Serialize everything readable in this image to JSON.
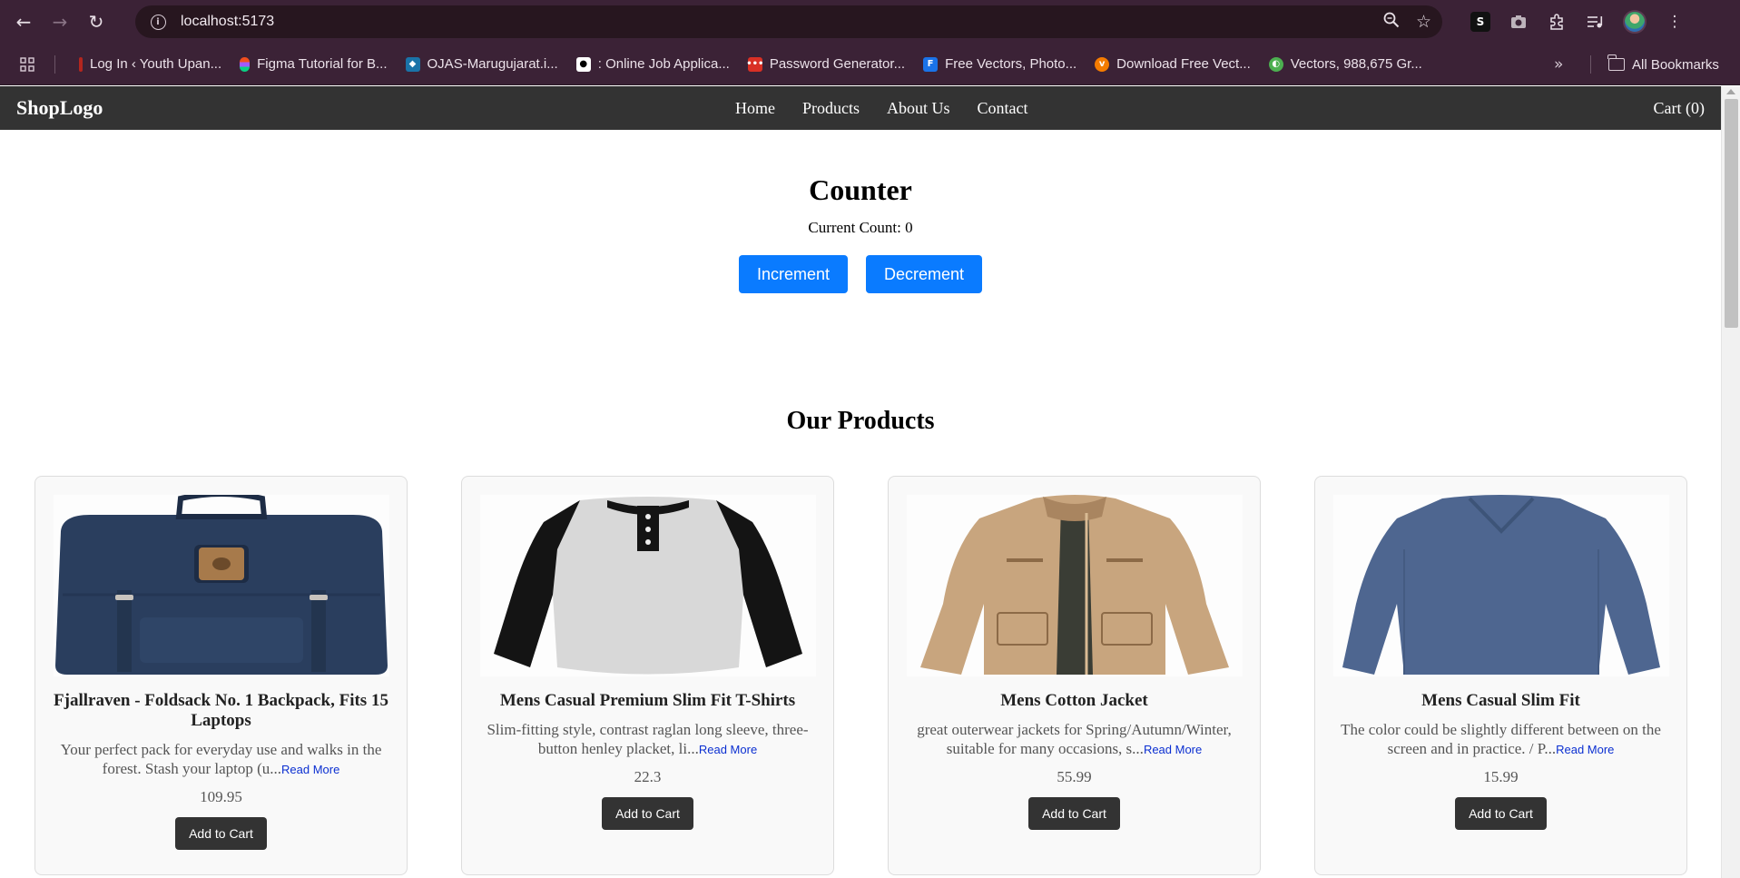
{
  "browser": {
    "url": "localhost:5173",
    "bookmarks": [
      {
        "label": "Log In ‹ Youth Upan...",
        "icon": "bookmark-favicon-red",
        "color": "#b3261e"
      },
      {
        "label": "Figma Tutorial for B...",
        "icon": "figma-icon",
        "color": "#f24e1e"
      },
      {
        "label": "OJAS-Marugujarat.i...",
        "icon": "bookmark-favicon-ojas",
        "color": "#1a73a8"
      },
      {
        "label": ": Online Job Applica...",
        "icon": "bookmark-favicon-job",
        "color": "#ffffff"
      },
      {
        "label": "Password Generator...",
        "icon": "bookmark-favicon-password",
        "color": "#d93025"
      },
      {
        "label": "Free Vectors, Photo...",
        "icon": "bookmark-favicon-freepik",
        "color": "#1a73e8"
      },
      {
        "label": "Download Free Vect...",
        "icon": "bookmark-favicon-vecteezy",
        "color": "#f57c00"
      },
      {
        "label": "Vectors, 988,675 Gr...",
        "icon": "bookmark-favicon-vectors",
        "color": "#4caf50"
      }
    ],
    "all_bookmarks_label": "All Bookmarks"
  },
  "site": {
    "logo": "ShopLogo",
    "nav": [
      "Home",
      "Products",
      "About Us",
      "Contact"
    ],
    "cart_label": "Cart (0)"
  },
  "counter": {
    "title": "Counter",
    "count_line": "Current Count: 0",
    "increment_label": "Increment",
    "decrement_label": "Decrement"
  },
  "products_heading": "Our Products",
  "products": [
    {
      "title": "Fjallraven - Foldsack No. 1 Backpack, Fits 15 Laptops",
      "desc": "Your perfect pack for everyday use and walks in the forest. Stash your laptop (u...",
      "read_more": "Read More",
      "price": "109.95",
      "button": "Add to Cart",
      "image": "backpack-image"
    },
    {
      "title": "Mens Casual Premium Slim Fit T-Shirts",
      "desc": "Slim-fitting style, contrast raglan long sleeve, three-button henley placket, li...",
      "read_more": "Read More",
      "price": "22.3",
      "button": "Add to Cart",
      "image": "tshirt-image"
    },
    {
      "title": "Mens Cotton Jacket",
      "desc": "great outerwear jackets for Spring/Autumn/Winter, suitable for many occasions, s...",
      "read_more": "Read More",
      "price": "55.99",
      "button": "Add to Cart",
      "image": "jacket-image"
    },
    {
      "title": "Mens Casual Slim Fit",
      "desc": "The color could be slightly different between on the screen and in practice. / P...",
      "read_more": "Read More",
      "price": "15.99",
      "button": "Add to Cart",
      "image": "slim-fit-shirt-image"
    }
  ],
  "colors": {
    "chrome": "#3b2236",
    "site_nav": "#333333",
    "primary_button": "#0a7bff",
    "dark_button": "#333333",
    "link": "#0b2fd1"
  }
}
